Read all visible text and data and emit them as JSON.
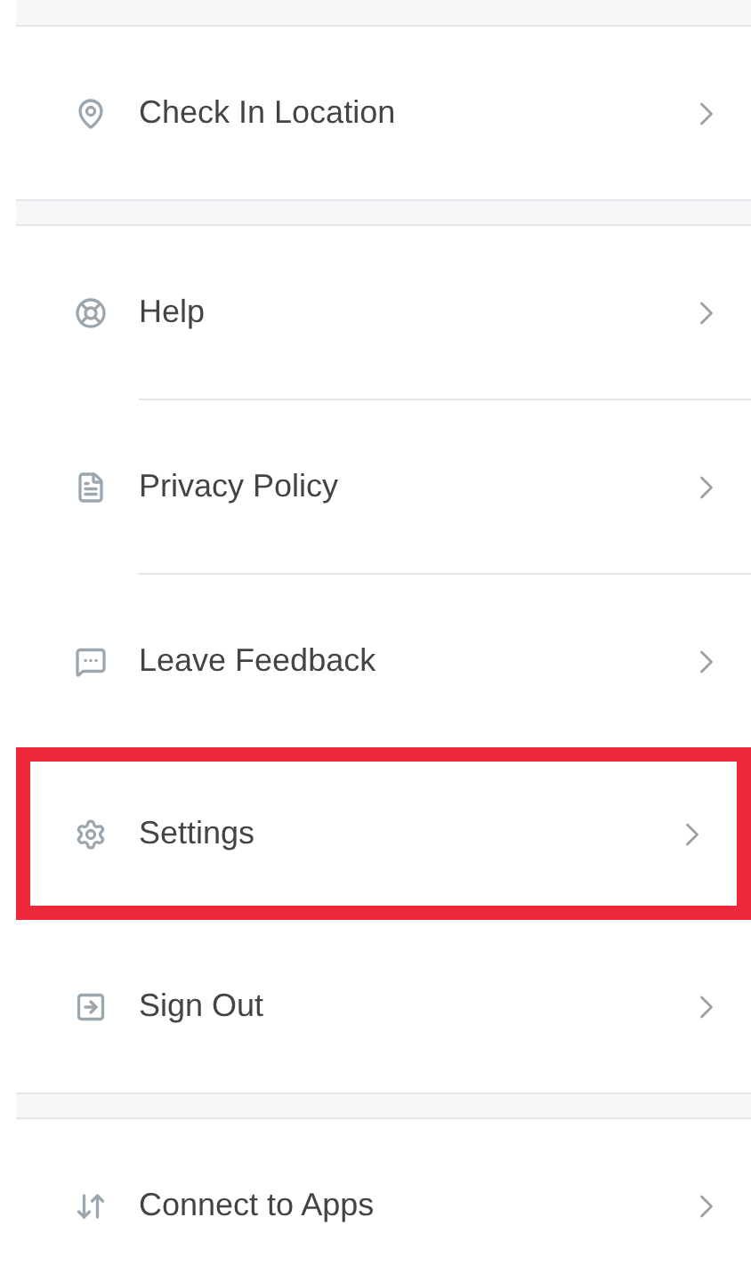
{
  "menu_groups": [
    {
      "items": [
        {
          "label": "Check In Location",
          "selected": false
        }
      ]
    },
    {
      "items": [
        {
          "label": "Help",
          "selected": false
        },
        {
          "label": "Privacy Policy",
          "selected": false
        },
        {
          "label": "Leave Feedback",
          "selected": false
        },
        {
          "label": "Settings",
          "selected": true
        },
        {
          "label": "Sign Out",
          "selected": false
        }
      ]
    },
    {
      "items": [
        {
          "label": "Connect to Apps",
          "selected": false
        }
      ]
    }
  ]
}
